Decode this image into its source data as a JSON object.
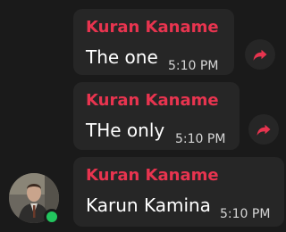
{
  "messages": [
    {
      "sender": "Kuran Kaname",
      "text": "The one",
      "time": "5:10 PM"
    },
    {
      "sender": "Kuran Kaname",
      "text": "THe only",
      "time": "5:10 PM"
    },
    {
      "sender": "Kuran Kaname",
      "text": "Karun Kamina",
      "time": "5:10 PM"
    }
  ],
  "colors": {
    "sender": "#e8344f",
    "bubble": "#262626",
    "background": "#1a1a1a",
    "online": "#22c55e"
  },
  "icons": {
    "forward": "share-arrow-icon",
    "avatar": "user-photo"
  }
}
